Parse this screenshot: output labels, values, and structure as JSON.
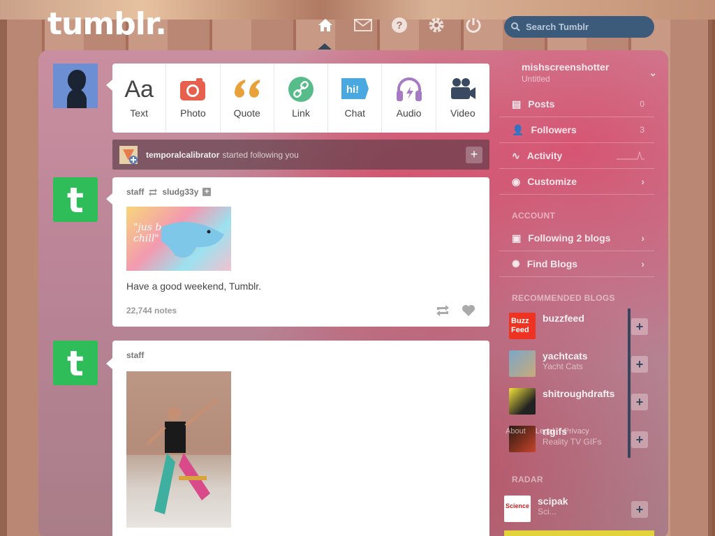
{
  "header": {
    "logo": "tumblr.",
    "search_placeholder": "Search Tumblr"
  },
  "nav_icons": [
    "home-icon",
    "mail-icon",
    "help-icon",
    "settings-icon",
    "power-icon"
  ],
  "poster": {
    "buttons": [
      {
        "label": "Text",
        "icon": "Aa"
      },
      {
        "label": "Photo",
        "icon": "camera-icon"
      },
      {
        "label": "Quote",
        "icon": "quote-icon"
      },
      {
        "label": "Link",
        "icon": "link-icon"
      },
      {
        "label": "Chat",
        "icon": "hi!"
      },
      {
        "label": "Audio",
        "icon": "headphones-icon"
      },
      {
        "label": "Video",
        "icon": "video-camera-icon"
      }
    ]
  },
  "notification": {
    "user": "temporalcalibrator",
    "text": "started following you"
  },
  "posts": [
    {
      "author": "staff",
      "reblogged_from": "sludg33y",
      "image_text": "\"jus b chill\"",
      "caption": "Have a good weekend, Tumblr.",
      "notes": "22,744 notes"
    },
    {
      "author": "staff"
    }
  ],
  "sidebar": {
    "blog": {
      "name": "mishscreenshotter",
      "subtitle": "Untitled"
    },
    "items": [
      {
        "label": "Posts",
        "count": "0"
      },
      {
        "label": "Followers",
        "count": "3"
      },
      {
        "label": "Activity"
      },
      {
        "label": "Customize"
      }
    ],
    "account_heading": "ACCOUNT",
    "account_items": [
      {
        "label": "Following 2 blogs"
      },
      {
        "label": "Find Blogs"
      }
    ],
    "recommended_heading": "RECOMMENDED BLOGS",
    "recommended": [
      {
        "name": "buzzfeed",
        "sub": "",
        "avatar_text": "Buzz Feed"
      },
      {
        "name": "yachtcats",
        "sub": "Yacht Cats"
      },
      {
        "name": "shitroughdrafts",
        "sub": ""
      },
      {
        "name": "rtgifs",
        "sub": "Reality TV GIFs"
      }
    ],
    "footer_links": [
      "About",
      "Legal",
      "Privacy"
    ],
    "radar_heading": "RADAR",
    "radar": {
      "name": "scipak",
      "sub": "Sci...",
      "avatar_text": "Science"
    }
  },
  "colors": {
    "navy": "#36465d",
    "brand_green": "#2ebd59",
    "photo_red": "#e6604d",
    "quote_orange": "#e9a23a",
    "link_green": "#56bc8a",
    "chat_blue": "#4aa8e0",
    "audio_purple": "#a67ac4",
    "video_dark": "#3a4a60"
  }
}
